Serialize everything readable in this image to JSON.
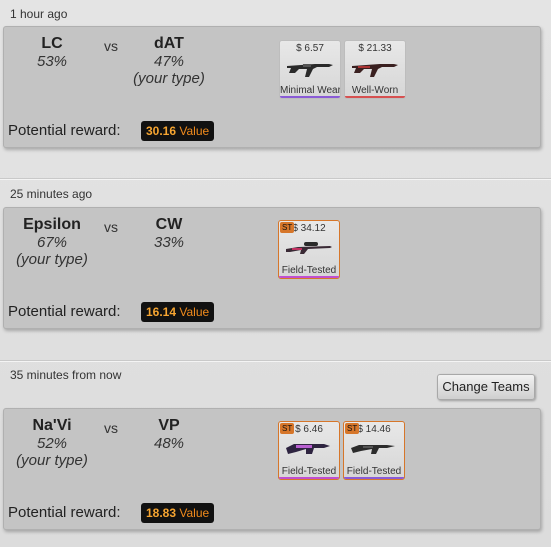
{
  "matches": [
    {
      "time": "1 hour ago",
      "team_a": {
        "name": "LC",
        "percent": "53%",
        "your_type": ""
      },
      "vs": "vs",
      "team_b": {
        "name": "dAT",
        "percent": "47%",
        "your_type": "(your type)"
      },
      "reward_label": "Potential reward:",
      "reward_value": "30.16",
      "reward_unit": "Value",
      "items": [
        {
          "price": "$ 6.57",
          "condition": "Minimal Wear",
          "stattrak": false,
          "quality_color": "#8a5bd6",
          "gun_icon": "rifle-icon"
        },
        {
          "price": "$ 21.33",
          "condition": "Well-Worn",
          "stattrak": false,
          "quality_color": "#d65050",
          "gun_icon": "rifle-icon"
        }
      ]
    },
    {
      "time": "25 minutes ago",
      "team_a": {
        "name": "Epsilon",
        "percent": "67%",
        "your_type": "(your type)"
      },
      "vs": "vs",
      "team_b": {
        "name": "CW",
        "percent": "33%",
        "your_type": ""
      },
      "reward_label": "Potential reward:",
      "reward_value": "16.14",
      "reward_unit": "Value",
      "items": [
        {
          "price": "$ 34.12",
          "condition": "Field-Tested",
          "stattrak": true,
          "stattrak_label": "ST",
          "quality_color": "#c04fd0",
          "gun_icon": "sniper-icon"
        }
      ]
    },
    {
      "time": "35 minutes from now",
      "team_a": {
        "name": "Na'Vi",
        "percent": "52%",
        "your_type": "(your type)"
      },
      "vs": "vs",
      "team_b": {
        "name": "VP",
        "percent": "48%",
        "your_type": ""
      },
      "reward_label": "Potential reward:",
      "reward_value": "18.83",
      "reward_unit": "Value",
      "items": [
        {
          "price": "$ 6.46",
          "condition": "Field-Tested",
          "stattrak": true,
          "stattrak_label": "ST",
          "quality_color": "#c04fd0",
          "gun_icon": "bullpup-icon"
        },
        {
          "price": "$ 14.46",
          "condition": "Field-Tested",
          "stattrak": true,
          "stattrak_label": "ST",
          "quality_color": "#8a5bd6",
          "gun_icon": "rifle-icon"
        }
      ]
    }
  ],
  "change_teams_label": "Change Teams",
  "colors": {
    "card_bg": "#c4c4c4",
    "reward_bg": "#111111",
    "reward_text": "#f6a531",
    "stattrak": "#d6762a"
  }
}
